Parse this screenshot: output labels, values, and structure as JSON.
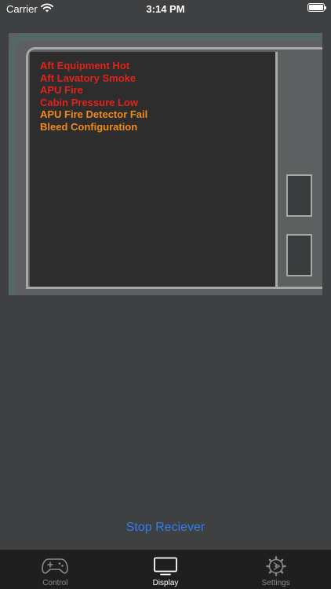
{
  "status_bar": {
    "carrier": "Carrier",
    "time": "3:14 PM"
  },
  "display": {
    "messages": [
      {
        "text": "Aft Equipment Hot",
        "color": "#e0241c"
      },
      {
        "text": "Aft Lavatory Smoke",
        "color": "#e0241c"
      },
      {
        "text": "APU Fire",
        "color": "#e0241c"
      },
      {
        "text": "Cabin Pressure Low",
        "color": "#e0241c"
      },
      {
        "text": "APU Fire Detector Fail",
        "color": "#f08a1e"
      },
      {
        "text": "Bleed Configuration",
        "color": "#f08a1e"
      }
    ]
  },
  "actions": {
    "stop_receiver": "Stop Reciever",
    "link_color": "#2f7ff0"
  },
  "tab_bar": {
    "tabs": [
      {
        "label": "Control",
        "icon": "gamepad-icon",
        "active": false
      },
      {
        "label": "Display",
        "icon": "monitor-icon",
        "active": true
      },
      {
        "label": "Settings",
        "icon": "gear-icon",
        "active": false
      }
    ]
  }
}
